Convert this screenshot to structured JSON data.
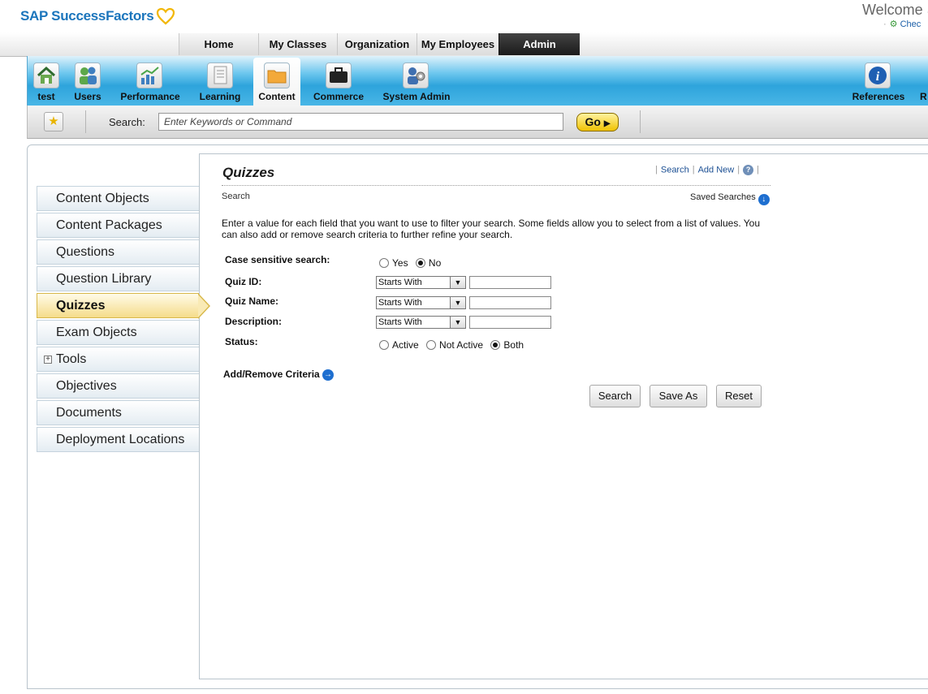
{
  "header": {
    "logo_text": "SAP SuccessFactors",
    "welcome_text": "Welcome S",
    "check_link": "Chec"
  },
  "top_nav": {
    "tabs": [
      {
        "label": "Home",
        "active": false
      },
      {
        "label": "My Classes",
        "active": false
      },
      {
        "label": "Organization",
        "active": false
      },
      {
        "label": "My Employees",
        "active": false
      },
      {
        "label": "Admin",
        "active": true
      }
    ]
  },
  "admin_tools": [
    {
      "label": "test",
      "icon": "house-icon"
    },
    {
      "label": "Users",
      "icon": "users-icon"
    },
    {
      "label": "Performance",
      "icon": "chart-icon"
    },
    {
      "label": "Learning",
      "icon": "document-icon"
    },
    {
      "label": "Content",
      "icon": "folder-icon",
      "active": true
    },
    {
      "label": "Commerce",
      "icon": "briefcase-icon"
    },
    {
      "label": "System Admin",
      "icon": "admin-gear-icon"
    },
    {
      "label": "References",
      "icon": "info-icon"
    },
    {
      "label": "R",
      "icon": "truncated-icon"
    }
  ],
  "search_bar": {
    "label": "Search:",
    "placeholder": "Enter Keywords or Command",
    "go_label": "Go"
  },
  "left_nav": {
    "items": [
      {
        "label": "Content Objects"
      },
      {
        "label": "Content Packages"
      },
      {
        "label": "Questions"
      },
      {
        "label": "Question Library"
      },
      {
        "label": "Quizzes",
        "active": true
      },
      {
        "label": "Exam Objects"
      },
      {
        "label": "Tools",
        "expandable": true
      },
      {
        "label": "Objectives"
      },
      {
        "label": "Documents"
      },
      {
        "label": "Deployment Locations"
      }
    ]
  },
  "page": {
    "title": "Quizzes",
    "links": {
      "search": "Search",
      "add_new": "Add New"
    },
    "sub_label": "Search",
    "saved_searches": "Saved Searches",
    "instructions": "Enter a value for each field that you want to use to filter your search. Some fields allow you to select from a list of values. You can also add or remove search criteria to further refine your search."
  },
  "form": {
    "case_sensitive": {
      "label": "Case sensitive search:",
      "options": [
        "Yes",
        "No"
      ],
      "selected": "No"
    },
    "quiz_id": {
      "label": "Quiz ID:",
      "operator": "Starts With",
      "value": ""
    },
    "quiz_name": {
      "label": "Quiz Name:",
      "operator": "Starts With",
      "value": ""
    },
    "description": {
      "label": "Description:",
      "operator": "Starts With",
      "value": ""
    },
    "status": {
      "label": "Status:",
      "options": [
        "Active",
        "Not Active",
        "Both"
      ],
      "selected": "Both"
    },
    "add_remove_label": "Add/Remove Criteria"
  },
  "buttons": {
    "search": "Search",
    "save_as": "Save As",
    "reset": "Reset"
  },
  "colors": {
    "brand_blue": "#1b75bc",
    "heart_gold": "#f2b705",
    "toolbar_blue": "#2ea4dc",
    "admin_tab": "#1a1a1a",
    "active_nav": "#f5dc8a"
  }
}
